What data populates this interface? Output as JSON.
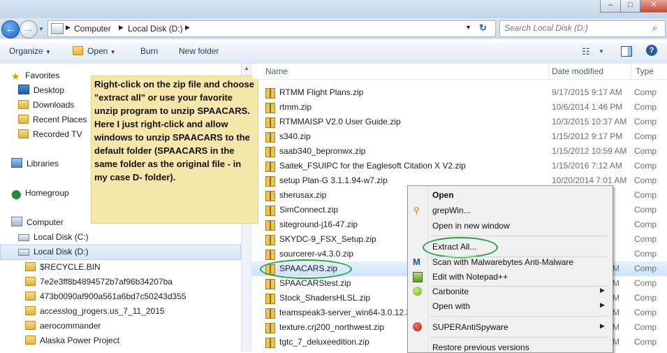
{
  "window": {
    "minimize": "–",
    "maximize": "□",
    "close": "✕"
  },
  "address": {
    "crumbs": [
      "Computer",
      "Local Disk (D:)"
    ],
    "search_placeholder": "Search Local Disk (D:)"
  },
  "toolbar": {
    "organize": "Organize",
    "open": "Open",
    "burn": "Burn",
    "new_folder": "New folder"
  },
  "nav": {
    "favorites": "Favorites",
    "favorite_items": [
      "Desktop",
      "Downloads",
      "Recent Places",
      "Recorded TV"
    ],
    "libraries": "Libraries",
    "homegroup": "Homegroup",
    "computer": "Computer",
    "drives": [
      "Local Disk (C:)",
      "Local Disk (D:)"
    ],
    "folders": [
      "$RECYCLE.BIN",
      "7e2e3ff8b4894572b7af96b34207ba",
      "473b0090af900a561a6bd7c50243d355",
      "accesslog_jrogers.us_7_11_2015",
      "aerocommander",
      "Alaska Power Project"
    ]
  },
  "note": "Right-click on the zip file and choose \"extract all\" or use your favorite unzip program to unzip SPAACARS.  Here I just right-click and allow windows to unzip SPAACARS to the default folder (SPAACARS in the same folder as the original file - in my case D- folder).",
  "columns": {
    "name": "Name",
    "date": "Date modified",
    "type": "Type"
  },
  "files": [
    {
      "name": "RTMM Flight Plans.zip",
      "date": "9/17/2015 9:17 AM",
      "type": "Comp"
    },
    {
      "name": "rtmm.zip",
      "date": "10/6/2014 1:46 PM",
      "type": "Comp"
    },
    {
      "name": "RTMMAISP V2.0 User Guide.zip",
      "date": "10/3/2015 10:37 AM",
      "type": "Comp"
    },
    {
      "name": "s340.zip",
      "date": "1/15/2012 9:17 PM",
      "type": "Comp"
    },
    {
      "name": "saab340_bepronwx.zip",
      "date": "1/15/2012 10:59 AM",
      "type": "Comp"
    },
    {
      "name": "Saitek_FSUIPC for the Eaglesoft Citation X V2.zip",
      "date": "1/15/2016 7:12 AM",
      "type": "Comp"
    },
    {
      "name": "setup Plan-G 3.1.1.94-w7.zip",
      "date": "10/20/2014 7:01 AM",
      "type": "Comp"
    },
    {
      "name": "sherusax.zip",
      "date": "",
      "type": "Comp"
    },
    {
      "name": "SimConnect.zip",
      "date": "",
      "type": "Comp"
    },
    {
      "name": "siteground-j16-47.zip",
      "date": "",
      "type": "Comp"
    },
    {
      "name": "SKYDC-9_FSX_Setup.zip",
      "date": "",
      "type": "Comp"
    },
    {
      "name": "sourcerer-v4.3.0.zip",
      "date": "",
      "type": "Comp"
    },
    {
      "name": "SPAACARS.zip",
      "date": "M",
      "type": "Comp"
    },
    {
      "name": "SPAACARStest.zip",
      "date": "M",
      "type": "Comp"
    },
    {
      "name": "Stock_ShadersHLSL.zip",
      "date": "M",
      "type": "Comp"
    },
    {
      "name": "teamspeak3-server_win64-3.0.12.3.",
      "date": "M",
      "type": "Comp"
    },
    {
      "name": "texture.crj200_northwest.zip",
      "date": "M",
      "type": "Comp"
    },
    {
      "name": "tgtc_7_deluxeedition.zip",
      "date": "M",
      "type": "Comp"
    }
  ],
  "context_menu": {
    "open": "Open",
    "grepwin": "grepWin...",
    "open_new_window": "Open in new window",
    "extract_all": "Extract All...",
    "scan": "Scan with Malwarebytes Anti-Malware",
    "edit_notepad": "Edit with Notepad++",
    "carbonite": "Carbonite",
    "open_with": "Open with",
    "superantispyware": "SUPERAntiSpyware",
    "restore": "Restore previous versions"
  },
  "colors": {
    "highlight_oval": "#1fa33d",
    "note_bg": "#f5e6a9",
    "selection": "#cfe3f9"
  }
}
